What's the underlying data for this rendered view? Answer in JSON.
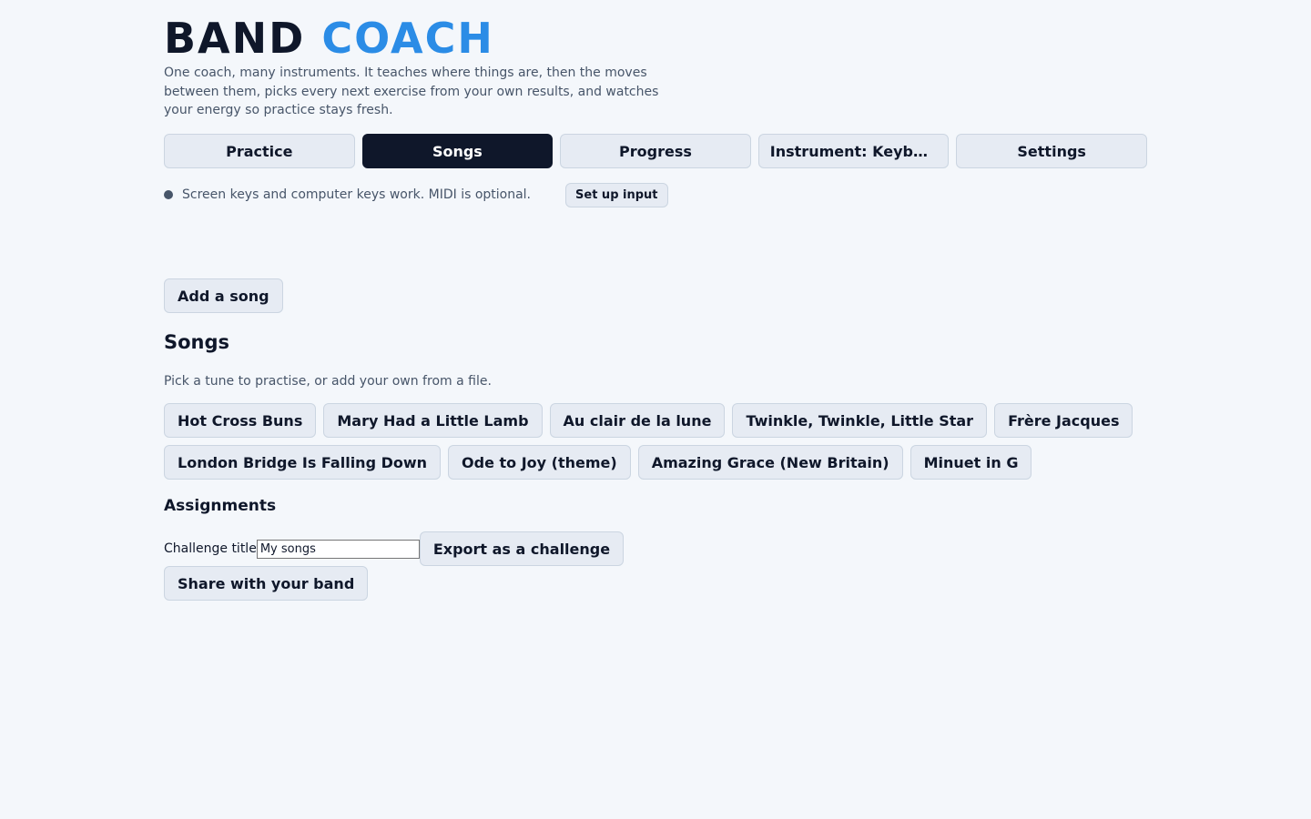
{
  "brand": {
    "part1": "BAND",
    "part2": "COACH",
    "accent_color": "#2b8ce6"
  },
  "tagline": "One coach, many instruments. It teaches where things are, then the moves between them, picks every next exercise from your own results, and watches your energy so practice stays fresh.",
  "tabs": [
    {
      "label": "Practice",
      "active": false
    },
    {
      "label": "Songs",
      "active": true
    },
    {
      "label": "Progress",
      "active": false
    },
    {
      "label": "Instrument: Keybo...",
      "active": false
    },
    {
      "label": "Settings",
      "active": false
    }
  ],
  "status": {
    "icon": "status-dot-icon",
    "text": "Screen keys and computer keys work. MIDI is optional.",
    "setup_label": "Set up input"
  },
  "add_song_label": "Add a song",
  "songs": {
    "title": "Songs",
    "subtitle": "Pick a tune to practise, or add your own from a file.",
    "items": [
      "Hot Cross Buns",
      "Mary Had a Little Lamb",
      "Au clair de la lune",
      "Twinkle, Twinkle, Little Star",
      "Frère Jacques",
      "London Bridge Is Falling Down",
      "Ode to Joy (theme)",
      "Amazing Grace (New Britain)",
      "Minuet in G"
    ]
  },
  "assignments": {
    "title": "Assignments",
    "challenge_label": "Challenge title",
    "challenge_value": "My songs",
    "export_label": "Export as a challenge",
    "share_label": "Share with your band"
  }
}
